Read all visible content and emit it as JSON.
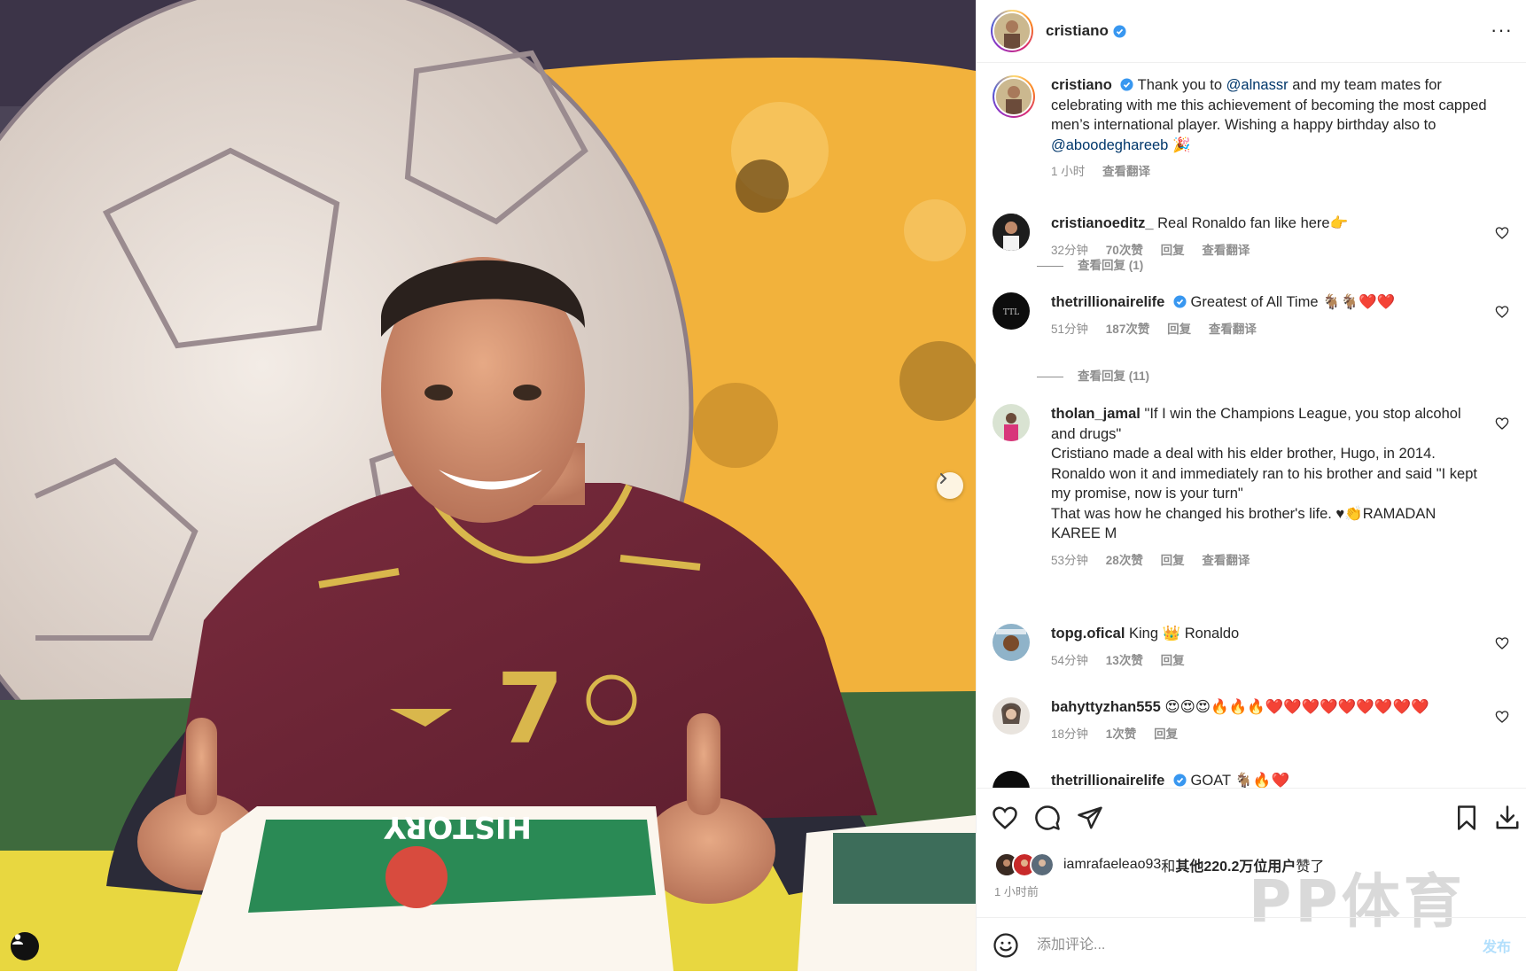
{
  "post": {
    "username": "cristiano",
    "more_label": "···",
    "caption_username": "cristiano",
    "caption_parts": [
      "Thank you to ",
      "@alnassr",
      " and my team mates for celebrating with me this achievement of becoming the most capped men’s international player. Wishing a happy birthday also to ",
      "@aboodeghareeb",
      " 🎉"
    ],
    "caption_time": "1 小时",
    "caption_translate": "查看翻译"
  },
  "comments": [
    {
      "user": "cristianoeditz_",
      "text": "Real Ronaldo fan like here👉",
      "time": "32分钟",
      "likes": "70次赞",
      "reply": "回复",
      "translate": "查看翻译",
      "view_replies": "查看回复 (1)"
    },
    {
      "user": "thetrillionairelife",
      "verified": true,
      "text": "Greatest of All Time 🐐🐐❤️❤️",
      "time": "51分钟",
      "likes": "187次赞",
      "reply": "回复",
      "translate": "查看翻译",
      "view_replies": "查看回复 (11)"
    },
    {
      "user": "tholan_jamal",
      "text": "\"If I win the Champions League, you stop alcohol and drugs\"",
      "text_lines": [
        "Cristiano made a deal with his elder brother, Hugo, in 2014.",
        "Ronaldo won it and immediately ran to his brother and said \"I kept my promise, now is your turn\"",
        "That was how he changed his brother's life. ♥👏RAMADAN KAREE M"
      ],
      "time": "53分钟",
      "likes": "28次赞",
      "reply": "回复",
      "translate": "查看翻译"
    },
    {
      "user": "topg.ofical",
      "text": "King 👑 Ronaldo",
      "time": "54分钟",
      "likes": "13次赞",
      "reply": "回复"
    },
    {
      "user": "bahyttyzhan555",
      "text": "😍😍😍🔥🔥🔥❤️❤️❤️❤️❤️❤️❤️❤️❤️",
      "time": "18分钟",
      "likes": "1次赞",
      "reply": "回复"
    },
    {
      "user": "thetrillionairelife",
      "verified": true,
      "text": "GOAT 🐐🔥❤️"
    }
  ],
  "likes": {
    "user": "iamrafaeleao93",
    "text_mid": "和",
    "others": "其他220.2万位用户",
    "text_end": "赞了"
  },
  "post_time": "1 小时前",
  "watermark": "PP体育",
  "composer": {
    "placeholder": "添加评论...",
    "post_label": "发布"
  },
  "icons": [
    "chevron-right-icon",
    "user-tag-icon",
    "heart-icon",
    "comment-icon",
    "share-icon",
    "bookmark-icon",
    "download-icon",
    "emoji-icon",
    "verified-icon",
    "more-icon"
  ],
  "colors": {
    "verified": "#3897f0",
    "mention": "#00376b",
    "muted": "#8e8e8e",
    "post_button": "#b2dffc"
  }
}
